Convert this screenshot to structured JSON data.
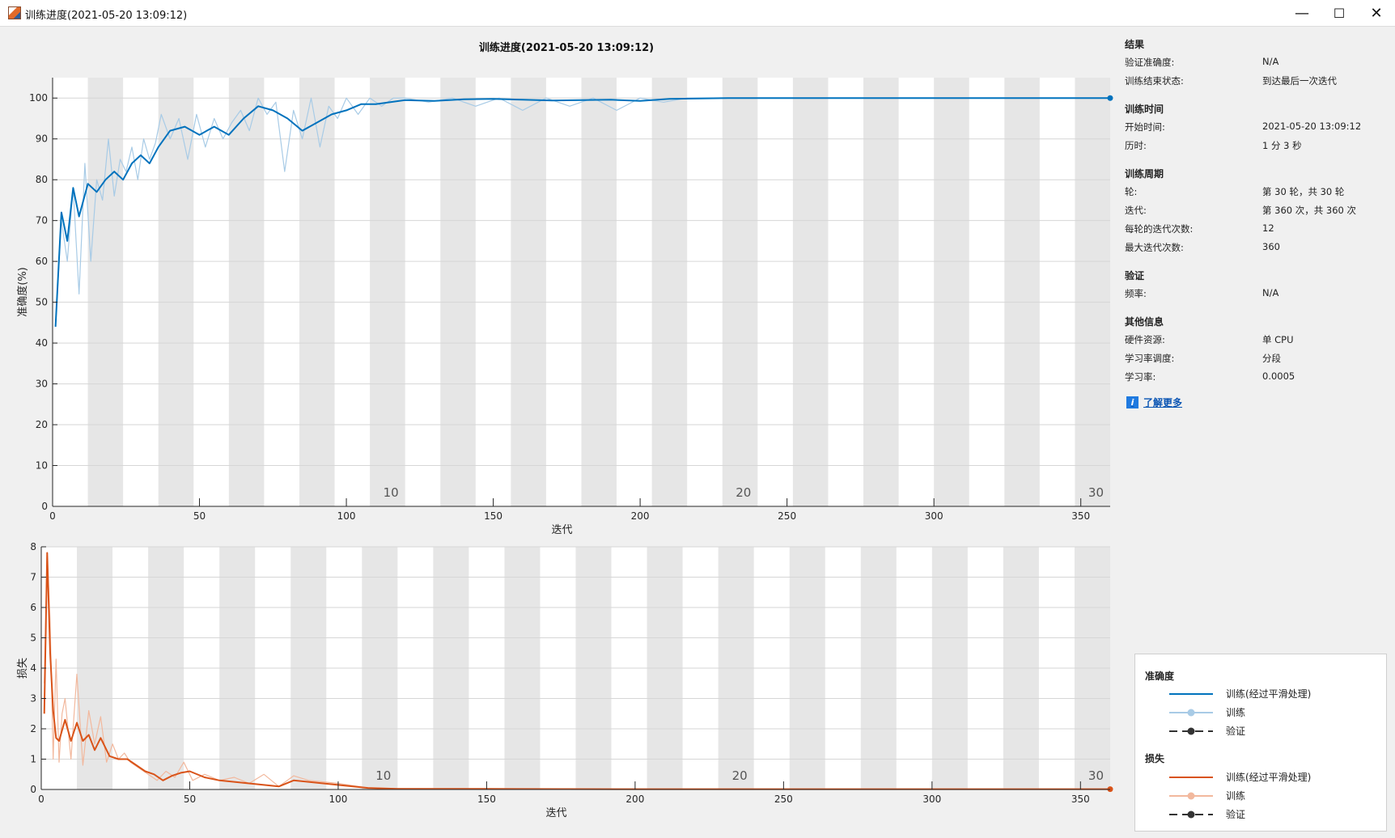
{
  "window": {
    "title": "训练进度(2021-05-20 13:09:12)",
    "minimize": "—",
    "maximize": "☐",
    "close": "✕"
  },
  "chart_title": "训练进度(2021-05-20 13:09:12)",
  "info": {
    "results": {
      "title": "结果",
      "rows": [
        {
          "label": "验证准确度:",
          "value": "N/A"
        },
        {
          "label": "训练结束状态:",
          "value": "到达最后一次迭代"
        }
      ]
    },
    "time": {
      "title": "训练时间",
      "rows": [
        {
          "label": "开始时间:",
          "value": "2021-05-20 13:09:12"
        },
        {
          "label": "历时:",
          "value": "1 分 3 秒"
        }
      ]
    },
    "cycle": {
      "title": "训练周期",
      "rows": [
        {
          "label": "轮:",
          "value": "第 30 轮，共 30 轮"
        },
        {
          "label": "迭代:",
          "value": "第 360 次，共 360 次"
        },
        {
          "label": "每轮的迭代次数:",
          "value": "12"
        },
        {
          "label": "最大迭代次数:",
          "value": "360"
        }
      ]
    },
    "validation": {
      "title": "验证",
      "rows": [
        {
          "label": "频率:",
          "value": "N/A"
        }
      ]
    },
    "other": {
      "title": "其他信息",
      "rows": [
        {
          "label": "硬件资源:",
          "value": "单 CPU"
        },
        {
          "label": "学习率调度:",
          "value": "分段"
        },
        {
          "label": "学习率:",
          "value": "0.0005"
        }
      ]
    },
    "learn_more": "了解更多"
  },
  "legend": {
    "accuracy_title": "准确度",
    "accuracy_items": [
      "训练(经过平滑处理)",
      "训练",
      "验证"
    ],
    "loss_title": "损失",
    "loss_items": [
      "训练(经过平滑处理)",
      "训练",
      "验证"
    ]
  },
  "colors": {
    "accuracy_smoothed": "#0072bd",
    "accuracy_raw": "#a8cbe6",
    "loss_smoothed": "#d95319",
    "loss_raw": "#f2b89d",
    "validation": "#333333",
    "epoch_shade": "#e6e6e6"
  },
  "chart_data": [
    {
      "type": "line",
      "xlabel": "迭代",
      "ylabel": "准确度(%)",
      "xlim": [
        0,
        360
      ],
      "ylim": [
        0,
        105
      ],
      "xticks": [
        0,
        50,
        100,
        150,
        200,
        250,
        300,
        350
      ],
      "yticks": [
        0,
        10,
        20,
        30,
        40,
        50,
        60,
        70,
        80,
        90,
        100
      ],
      "grid": true,
      "epoch_labels": [
        {
          "x": 120,
          "label": "10"
        },
        {
          "x": 240,
          "label": "20"
        },
        {
          "x": 360,
          "label": "30"
        }
      ],
      "iterations_per_epoch": 12,
      "series": [
        {
          "name": "训练(经过平滑处理)",
          "x": [
            1,
            3,
            5,
            7,
            9,
            12,
            15,
            18,
            21,
            24,
            27,
            30,
            33,
            36,
            40,
            45,
            50,
            55,
            60,
            65,
            70,
            75,
            80,
            85,
            90,
            95,
            100,
            105,
            110,
            115,
            120,
            130,
            140,
            150,
            160,
            170,
            180,
            190,
            200,
            210,
            220,
            230,
            240,
            260,
            280,
            300,
            320,
            340,
            360
          ],
          "values": [
            44,
            72,
            65,
            78,
            71,
            79,
            77,
            80,
            82,
            80,
            84,
            86,
            84,
            88,
            92,
            93,
            91,
            93,
            91,
            95,
            98,
            97,
            95,
            92,
            94,
            96,
            97,
            98.5,
            98.5,
            99,
            99.5,
            99.3,
            99.7,
            99.8,
            99.6,
            99.4,
            99.5,
            99.6,
            99.3,
            99.8,
            99.9,
            100,
            100,
            100,
            100,
            100,
            100,
            100,
            100
          ]
        },
        {
          "name": "训练",
          "x": [
            1,
            3,
            5,
            7,
            9,
            11,
            13,
            15,
            17,
            19,
            21,
            23,
            25,
            27,
            29,
            31,
            33,
            35,
            37,
            40,
            43,
            46,
            49,
            52,
            55,
            58,
            61,
            64,
            67,
            70,
            73,
            76,
            79,
            82,
            85,
            88,
            91,
            94,
            97,
            100,
            104,
            108,
            112,
            116,
            120,
            128,
            136,
            144,
            152,
            160,
            168,
            176,
            184,
            192,
            200,
            208,
            216,
            224,
            232,
            240,
            260,
            280,
            300,
            320,
            340,
            360
          ],
          "values": [
            44,
            70,
            60,
            78,
            52,
            84,
            60,
            80,
            75,
            90,
            76,
            85,
            82,
            88,
            80,
            90,
            85,
            89,
            96,
            90,
            95,
            85,
            96,
            88,
            95,
            90,
            94,
            97,
            92,
            100,
            96,
            99,
            82,
            97,
            90,
            100,
            88,
            98,
            95,
            100,
            96,
            100,
            98,
            100,
            100,
            99,
            100,
            98,
            100,
            97,
            100,
            98,
            100,
            97,
            100,
            99,
            100,
            100,
            100,
            100,
            100,
            100,
            100,
            100,
            100,
            100
          ]
        }
      ]
    },
    {
      "type": "line",
      "xlabel": "迭代",
      "ylabel": "损失",
      "xlim": [
        0,
        360
      ],
      "ylim": [
        0,
        8
      ],
      "xticks": [
        0,
        50,
        100,
        150,
        200,
        250,
        300,
        350
      ],
      "yticks": [
        0,
        1,
        2,
        3,
        4,
        5,
        6,
        7,
        8
      ],
      "grid": true,
      "epoch_labels": [
        {
          "x": 120,
          "label": "10"
        },
        {
          "x": 240,
          "label": "20"
        },
        {
          "x": 360,
          "label": "30"
        }
      ],
      "iterations_per_epoch": 12,
      "series": [
        {
          "name": "训练(经过平滑处理)",
          "x": [
            1,
            2,
            3,
            4,
            5,
            6,
            8,
            10,
            12,
            14,
            16,
            18,
            20,
            23,
            26,
            29,
            32,
            35,
            38,
            41,
            44,
            47,
            50,
            55,
            60,
            65,
            70,
            75,
            80,
            85,
            90,
            95,
            100,
            110,
            120,
            150,
            200,
            250,
            300,
            360
          ],
          "values": [
            2.5,
            7.8,
            4.5,
            2.6,
            1.7,
            1.6,
            2.3,
            1.6,
            2.2,
            1.6,
            1.8,
            1.3,
            1.7,
            1.1,
            1.0,
            1.0,
            0.8,
            0.6,
            0.5,
            0.3,
            0.45,
            0.55,
            0.6,
            0.4,
            0.3,
            0.25,
            0.2,
            0.15,
            0.1,
            0.3,
            0.25,
            0.2,
            0.15,
            0.05,
            0.02,
            0.02,
            0.01,
            0.01,
            0.01,
            0.01
          ]
        },
        {
          "name": "训练",
          "x": [
            1,
            2,
            3,
            4,
            5,
            6,
            7,
            8,
            10,
            12,
            14,
            16,
            18,
            20,
            22,
            24,
            26,
            28,
            30,
            33,
            36,
            39,
            42,
            45,
            48,
            51,
            55,
            60,
            65,
            70,
            75,
            80,
            85,
            90,
            95,
            100,
            110,
            120,
            150,
            200,
            250,
            300,
            360
          ],
          "values": [
            3.5,
            7.8,
            5.5,
            1.0,
            4.3,
            0.9,
            2.5,
            3.0,
            1.0,
            3.8,
            0.8,
            2.6,
            1.5,
            2.4,
            0.9,
            1.5,
            1.0,
            1.2,
            0.9,
            0.7,
            0.5,
            0.3,
            0.6,
            0.4,
            0.9,
            0.3,
            0.5,
            0.3,
            0.4,
            0.2,
            0.5,
            0.1,
            0.45,
            0.3,
            0.25,
            0.2,
            0.05,
            0.03,
            0.02,
            0.02,
            0.02,
            0.02,
            0.02
          ]
        }
      ]
    }
  ]
}
